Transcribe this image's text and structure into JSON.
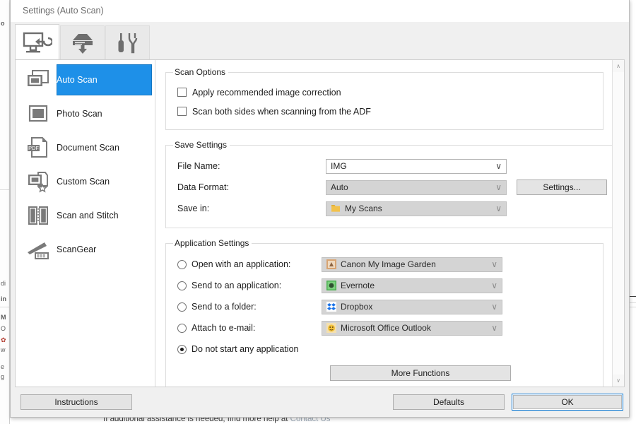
{
  "backdrop": {
    "bottom_text_prefix": "If additional assistance is needed, find more help at ",
    "bottom_text_link": "Contact Us",
    "left_fragments": [
      "o",
      "di",
      "in",
      "M",
      "O",
      "w",
      "e",
      "g"
    ]
  },
  "window": {
    "title": "Settings (Auto Scan)"
  },
  "tabs": [
    {
      "name": "scan-from-computer",
      "icon": "monitor-scan-icon",
      "active": true
    },
    {
      "name": "scan-from-scanner",
      "icon": "scanner-download-icon",
      "active": false
    },
    {
      "name": "general-settings",
      "icon": "tools-icon",
      "active": false
    }
  ],
  "sidebar": {
    "items": [
      {
        "label": "Auto Scan",
        "icon": "auto-scan-icon",
        "selected": true
      },
      {
        "label": "Photo Scan",
        "icon": "photo-scan-icon",
        "selected": false
      },
      {
        "label": "Document Scan",
        "icon": "pdf-document-icon",
        "selected": false
      },
      {
        "label": "Custom Scan",
        "icon": "custom-scan-icon",
        "selected": false
      },
      {
        "label": "Scan and Stitch",
        "icon": "scan-stitch-icon",
        "selected": false
      },
      {
        "label": "ScanGear",
        "icon": "scangear-icon",
        "selected": false
      }
    ],
    "selected_bg": "#1e90e8"
  },
  "scan_options": {
    "legend": "Scan Options",
    "checkboxes": [
      {
        "label": "Apply recommended image correction",
        "checked": false
      },
      {
        "label": "Scan both sides when scanning from the ADF",
        "checked": false
      }
    ]
  },
  "save_settings": {
    "legend": "Save Settings",
    "file_name": {
      "label": "File Name:",
      "value": "IMG",
      "disabled": false
    },
    "data_format": {
      "label": "Data Format:",
      "value": "Auto",
      "disabled": true
    },
    "save_in": {
      "label": "Save in:",
      "value": "My Scans",
      "icon": "folder-icon",
      "icon_color": "#f2c14a",
      "disabled": true
    },
    "settings_button": "Settings..."
  },
  "application_settings": {
    "legend": "Application Settings",
    "radios": [
      {
        "label": "Open with an application:",
        "selected": false,
        "value": "Canon My Image Garden",
        "icon": "canon-my-image-garden-icon",
        "icon_color": "#d8a472",
        "disabled": true
      },
      {
        "label": "Send to an application:",
        "selected": false,
        "value": "Evernote",
        "icon": "evernote-icon",
        "icon_color": "#4caf50",
        "disabled": true
      },
      {
        "label": "Send to a folder:",
        "selected": false,
        "value": "Dropbox",
        "icon": "dropbox-icon",
        "icon_color": "#1a73e8",
        "disabled": true
      },
      {
        "label": "Attach to e-mail:",
        "selected": false,
        "value": "Microsoft Office Outlook",
        "icon": "outlook-icon",
        "icon_color": "#f3c23b",
        "disabled": true
      },
      {
        "label": "Do not start any application",
        "selected": true,
        "value": null,
        "icon": null,
        "disabled": false
      }
    ],
    "more_functions_button": "More Functions"
  },
  "footer": {
    "instructions": "Instructions",
    "defaults": "Defaults",
    "ok": "OK",
    "ok_focus_color": "#0a78d4"
  },
  "scrollbar": {
    "up_glyph": "∧",
    "down_glyph": "∨"
  },
  "combo_arrow_glyph": "∨"
}
